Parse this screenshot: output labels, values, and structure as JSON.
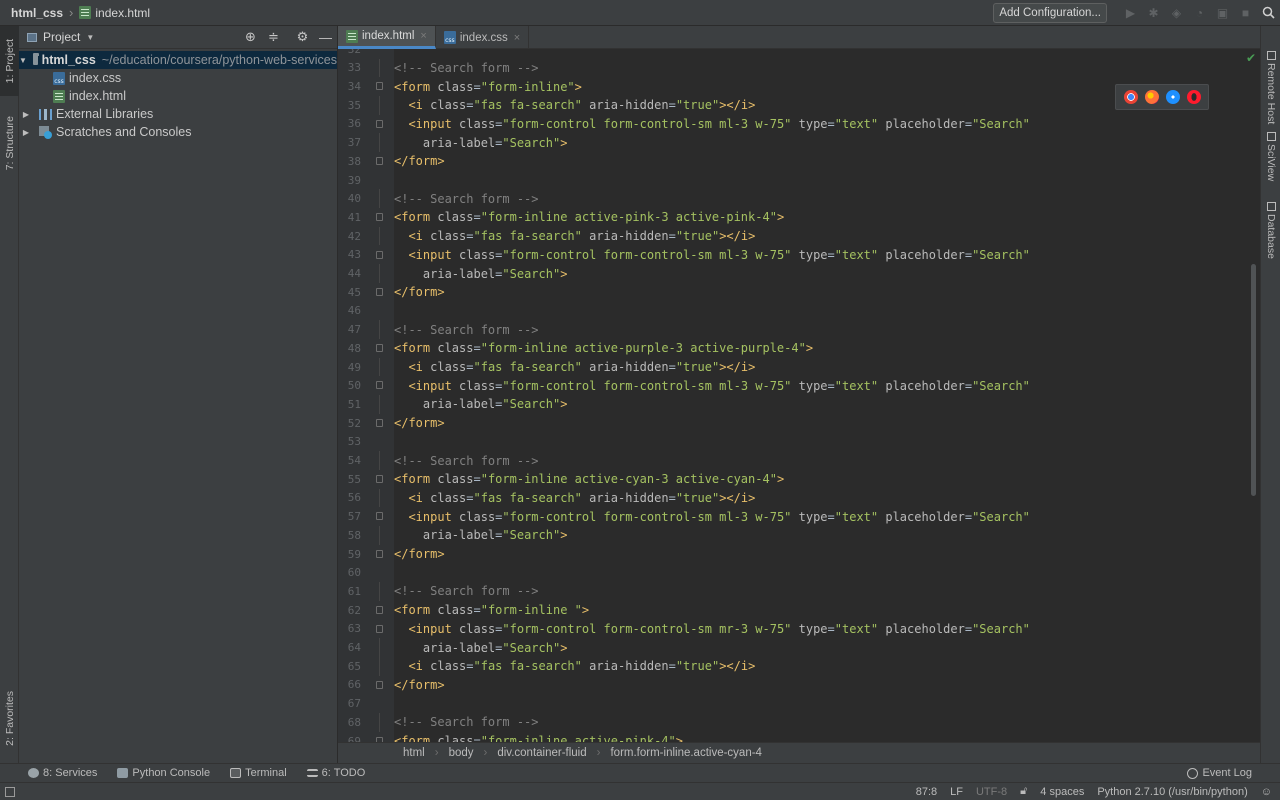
{
  "navbar": {
    "project": "html_css",
    "file": "index.html",
    "add_config": "Add Configuration...",
    "buttons": [
      "run",
      "debug",
      "coverage",
      "profile",
      "concurrency",
      "stop",
      "search"
    ]
  },
  "left_strip": {
    "project_tab": "1: Project",
    "structure_tab": "7: Structure",
    "favorites_tab": "2: Favorites"
  },
  "project": {
    "title": "Project",
    "root_name": "html_css",
    "root_path": "~/education/coursera/python-web-services",
    "files": [
      "index.css",
      "index.html"
    ],
    "external": "External Libraries",
    "scratches": "Scratches and Consoles"
  },
  "tabs": [
    {
      "label": "index.html",
      "active": true
    },
    {
      "label": "index.css",
      "active": false
    }
  ],
  "editor": {
    "first_line_partial": "32",
    "lines": [
      {
        "n": "33",
        "text": "<!-- Search form -->"
      },
      {
        "n": "34",
        "text": "<form class=\"form-inline\">"
      },
      {
        "n": "35",
        "text": "  <i class=\"fas fa-search\" aria-hidden=\"true\"></i>"
      },
      {
        "n": "36",
        "text": "  <input class=\"form-control form-control-sm ml-3 w-75\" type=\"text\" placeholder=\"Search\""
      },
      {
        "n": "37",
        "text": "    aria-label=\"Search\">"
      },
      {
        "n": "38",
        "text": "</form>"
      },
      {
        "n": "39",
        "text": ""
      },
      {
        "n": "40",
        "text": "<!-- Search form -->"
      },
      {
        "n": "41",
        "text": "<form class=\"form-inline active-pink-3 active-pink-4\">"
      },
      {
        "n": "42",
        "text": "  <i class=\"fas fa-search\" aria-hidden=\"true\"></i>"
      },
      {
        "n": "43",
        "text": "  <input class=\"form-control form-control-sm ml-3 w-75\" type=\"text\" placeholder=\"Search\""
      },
      {
        "n": "44",
        "text": "    aria-label=\"Search\">"
      },
      {
        "n": "45",
        "text": "</form>"
      },
      {
        "n": "46",
        "text": ""
      },
      {
        "n": "47",
        "text": "<!-- Search form -->"
      },
      {
        "n": "48",
        "text": "<form class=\"form-inline active-purple-3 active-purple-4\">"
      },
      {
        "n": "49",
        "text": "  <i class=\"fas fa-search\" aria-hidden=\"true\"></i>"
      },
      {
        "n": "50",
        "text": "  <input class=\"form-control form-control-sm ml-3 w-75\" type=\"text\" placeholder=\"Search\""
      },
      {
        "n": "51",
        "text": "    aria-label=\"Search\">"
      },
      {
        "n": "52",
        "text": "</form>"
      },
      {
        "n": "53",
        "text": ""
      },
      {
        "n": "54",
        "text": "<!-- Search form -->"
      },
      {
        "n": "55",
        "text": "<form class=\"form-inline active-cyan-3 active-cyan-4\">"
      },
      {
        "n": "56",
        "text": "  <i class=\"fas fa-search\" aria-hidden=\"true\"></i>"
      },
      {
        "n": "57",
        "text": "  <input class=\"form-control form-control-sm ml-3 w-75\" type=\"text\" placeholder=\"Search\""
      },
      {
        "n": "58",
        "text": "    aria-label=\"Search\">"
      },
      {
        "n": "59",
        "text": "</form>"
      },
      {
        "n": "60",
        "text": ""
      },
      {
        "n": "61",
        "text": "<!-- Search form -->"
      },
      {
        "n": "62",
        "text": "<form class=\"form-inline \">"
      },
      {
        "n": "63",
        "text": "  <input class=\"form-control form-control-sm mr-3 w-75\" type=\"text\" placeholder=\"Search\""
      },
      {
        "n": "64",
        "text": "    aria-label=\"Search\">"
      },
      {
        "n": "65",
        "text": "  <i class=\"fas fa-search\" aria-hidden=\"true\"></i>"
      },
      {
        "n": "66",
        "text": "</form>"
      },
      {
        "n": "67",
        "text": ""
      },
      {
        "n": "68",
        "text": "<!-- Search form -->"
      },
      {
        "n": "69",
        "text": "<form class=\"form-inline active-pink-4\">"
      }
    ]
  },
  "breadcrumbs": [
    "html",
    "body",
    "div.container-fluid",
    "form.form-inline.active-cyan-4"
  ],
  "right_strip": [
    "Remote Host",
    "SciView",
    "Database"
  ],
  "bottom_tools": [
    {
      "label": "8: Services",
      "icon": "services-icon"
    },
    {
      "label": "Python Console",
      "icon": "python-icon"
    },
    {
      "label": "Terminal",
      "icon": "terminal-icon"
    },
    {
      "label": "6: TODO",
      "icon": "todo-icon"
    }
  ],
  "event_log": "Event Log",
  "status": {
    "position": "87:8",
    "line_sep": "LF",
    "encoding": "UTF-8",
    "indent": "4 spaces",
    "interpreter": "Python 2.7.10 (/usr/bin/python)"
  },
  "colors": {
    "tag": "#e8bf6a",
    "attr": "#bababa",
    "value": "#a5c261",
    "comment": "#808080",
    "accent": "#4a88c7"
  }
}
